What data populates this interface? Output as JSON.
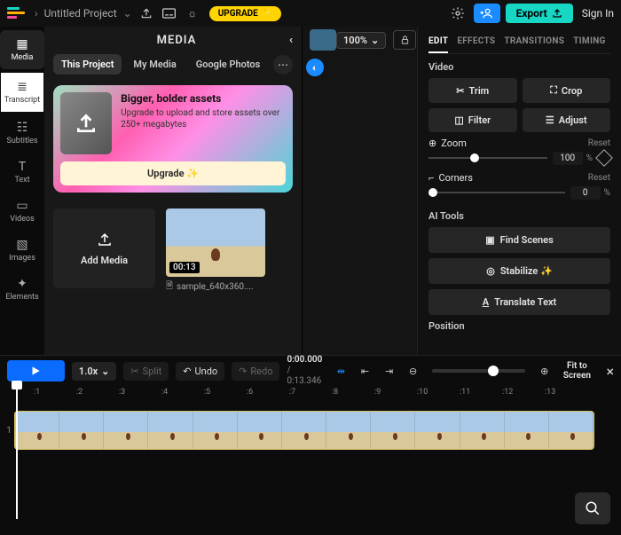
{
  "topbar": {
    "project_name": "Untitled Project",
    "upgrade": "UPGRADE",
    "export": "Export",
    "signin": "Sign In"
  },
  "tools": {
    "media": "Media",
    "transcript": "Transcript",
    "subtitles": "Subtitles",
    "text": "Text",
    "videos": "Videos",
    "images": "Images",
    "elements": "Elements"
  },
  "mediaPanel": {
    "title": "MEDIA",
    "tabs": {
      "thisProject": "This Project",
      "myMedia": "My Media",
      "googlePhotos": "Google Photos"
    },
    "promo": {
      "title": "Bigger, bolder assets",
      "body": "Upgrade to upload and store assets over 250+ megabytes",
      "cta": "Upgrade ✨"
    },
    "addMedia": "Add Media",
    "clip": {
      "duration": "00:13",
      "filename": "sample_640x360...."
    }
  },
  "preview": {
    "zoom": "100%"
  },
  "rightPanel": {
    "tabs": {
      "edit": "EDIT",
      "effects": "EFFECTS",
      "transitions": "TRANSITIONS",
      "timing": "TIMING"
    },
    "video": "Video",
    "trim": "Trim",
    "crop": "Crop",
    "filter": "Filter",
    "adjust": "Adjust",
    "zoom": "Zoom",
    "reset": "Reset",
    "zoomVal": "100",
    "percent": "%",
    "corners": "Corners",
    "cornersVal": "0",
    "aiTools": "AI Tools",
    "findScenes": "Find Scenes",
    "stabilize": "Stabilize ✨",
    "translate": "Translate Text",
    "position": "Position"
  },
  "timeline": {
    "speed": "1.0x",
    "split": "Split",
    "undo": "Undo",
    "redo": "Redo",
    "time1": "0:00.000",
    "time2": "/ 0:13.346",
    "fit": "Fit to Screen",
    "ticks": [
      ":1",
      ":2",
      ":3",
      ":4",
      ":5",
      ":6",
      ":7",
      ":8",
      ":9",
      ":10",
      ":11",
      ":12",
      ":13"
    ],
    "trackNum": "1"
  }
}
